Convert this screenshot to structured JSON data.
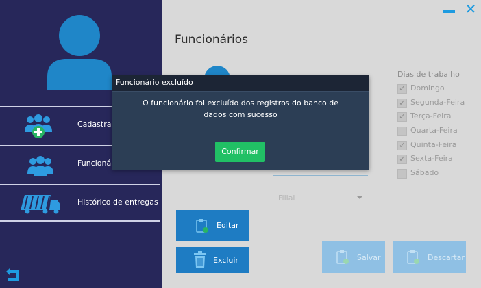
{
  "sidebar": {
    "items": [
      {
        "label": "Cadastrar",
        "icon": "add-group-icon"
      },
      {
        "label": "Funcionários",
        "icon": "group-icon"
      },
      {
        "label": "Histórico de entregas",
        "icon": "truck-icon"
      }
    ],
    "back_icon": "back-arrow-icon",
    "avatar_icon": "user-avatar-icon"
  },
  "window": {
    "minimize_icon": "minimize-icon",
    "close_icon": "close-icon",
    "close_glyph": "✕"
  },
  "main": {
    "title": "Funcionários",
    "days_title": "Dias de trabalho",
    "days": [
      {
        "label": "Domingo",
        "checked": true
      },
      {
        "label": "Segunda-Feira",
        "checked": true
      },
      {
        "label": "Terça-Feira",
        "checked": true
      },
      {
        "label": "Quarta-Feira",
        "checked": false
      },
      {
        "label": "Quinta-Feira",
        "checked": true
      },
      {
        "label": "Sexta-Feira",
        "checked": true
      },
      {
        "label": "Sábado",
        "checked": false
      }
    ],
    "filial_placeholder": "Filial",
    "buttons": {
      "editar": "Editar",
      "excluir": "Excluir",
      "salvar": "Salvar",
      "descartar": "Descartar"
    }
  },
  "dialog": {
    "title": "Funcionário excluído",
    "message": "O funcionário foi excluído dos registros do banco de dados com sucesso",
    "confirm": "Confirmar"
  },
  "colors": {
    "sidebar_bg": "#27275a",
    "accent": "#1e9be0",
    "button": "#1e7cc3",
    "confirm": "#21c065",
    "dialog_bg": "#2c3e55"
  }
}
